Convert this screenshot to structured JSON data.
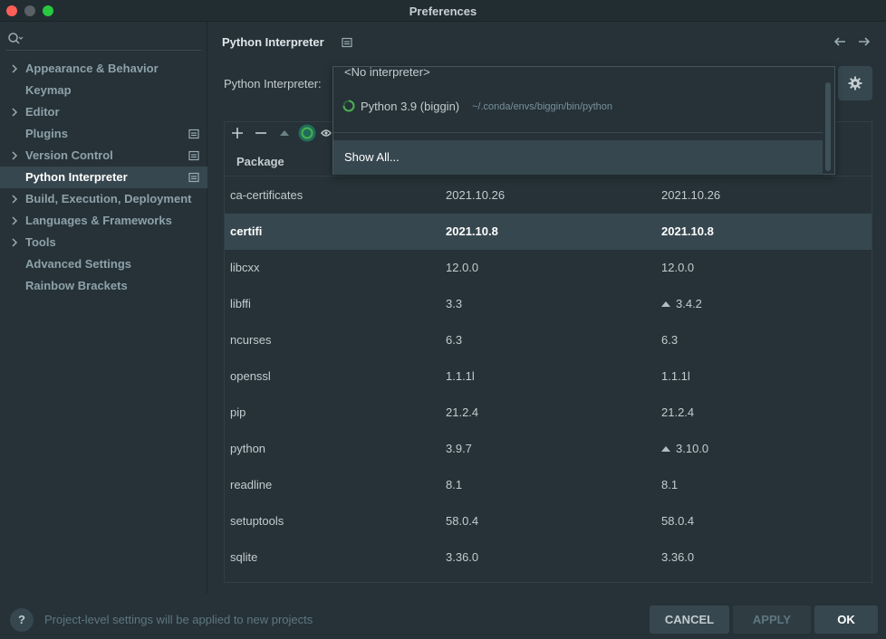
{
  "window": {
    "title": "Preferences"
  },
  "sidebar": {
    "items": [
      {
        "label": "Appearance & Behavior",
        "expandable": true,
        "badge": false
      },
      {
        "label": "Keymap",
        "expandable": false,
        "badge": false
      },
      {
        "label": "Editor",
        "expandable": true,
        "badge": false
      },
      {
        "label": "Plugins",
        "expandable": false,
        "badge": true
      },
      {
        "label": "Version Control",
        "expandable": true,
        "badge": true
      },
      {
        "label": "Python Interpreter",
        "expandable": false,
        "badge": true,
        "selected": true
      },
      {
        "label": "Build, Execution, Deployment",
        "expandable": true,
        "badge": false
      },
      {
        "label": "Languages & Frameworks",
        "expandable": true,
        "badge": false
      },
      {
        "label": "Tools",
        "expandable": true,
        "badge": false
      },
      {
        "label": "Advanced Settings",
        "expandable": false,
        "badge": false
      },
      {
        "label": "Rainbow Brackets",
        "expandable": false,
        "badge": false
      }
    ]
  },
  "main": {
    "title": "Python Interpreter",
    "interpreter_label": "Python Interpreter:",
    "table": {
      "columns": [
        "Package"
      ],
      "rows": [
        {
          "name": "ca-certificates",
          "version": "2021.10.26",
          "latest": "2021.10.26",
          "upgrade": false
        },
        {
          "name": "certifi",
          "version": "2021.10.8",
          "latest": "2021.10.8",
          "upgrade": false,
          "selected": true
        },
        {
          "name": "libcxx",
          "version": "12.0.0",
          "latest": "12.0.0",
          "upgrade": false
        },
        {
          "name": "libffi",
          "version": "3.3",
          "latest": "3.4.2",
          "upgrade": true
        },
        {
          "name": "ncurses",
          "version": "6.3",
          "latest": "6.3",
          "upgrade": false
        },
        {
          "name": "openssl",
          "version": "1.1.1l",
          "latest": "1.1.1l",
          "upgrade": false
        },
        {
          "name": "pip",
          "version": "21.2.4",
          "latest": "21.2.4",
          "upgrade": false
        },
        {
          "name": "python",
          "version": "3.9.7",
          "latest": "3.10.0",
          "upgrade": true
        },
        {
          "name": "readline",
          "version": "8.1",
          "latest": "8.1",
          "upgrade": false
        },
        {
          "name": "setuptools",
          "version": "58.0.4",
          "latest": "58.0.4",
          "upgrade": false
        },
        {
          "name": "sqlite",
          "version": "3.36.0",
          "latest": "3.36.0",
          "upgrade": false
        }
      ]
    }
  },
  "dropdown": {
    "no_interpreter": "<No interpreter>",
    "interpreter_name": "Python 3.9 (biggin)",
    "interpreter_path": "~/.conda/envs/biggin/bin/python",
    "show_all": "Show All..."
  },
  "footer": {
    "help": "?",
    "note": "Project-level settings will be applied to new projects",
    "cancel": "CANCEL",
    "apply": "APPLY",
    "ok": "OK"
  },
  "colors": {
    "background": "#263238",
    "selection": "#37474f",
    "accent_green": "#4caf50"
  },
  "icons": [
    "search-icon",
    "chevron-right-icon",
    "settings-badge-icon",
    "arrow-left-icon",
    "arrow-right-icon",
    "gear-icon",
    "plus-icon",
    "minus-icon",
    "upgrade-icon",
    "conda-icon",
    "eye-icon",
    "spinner-icon"
  ]
}
